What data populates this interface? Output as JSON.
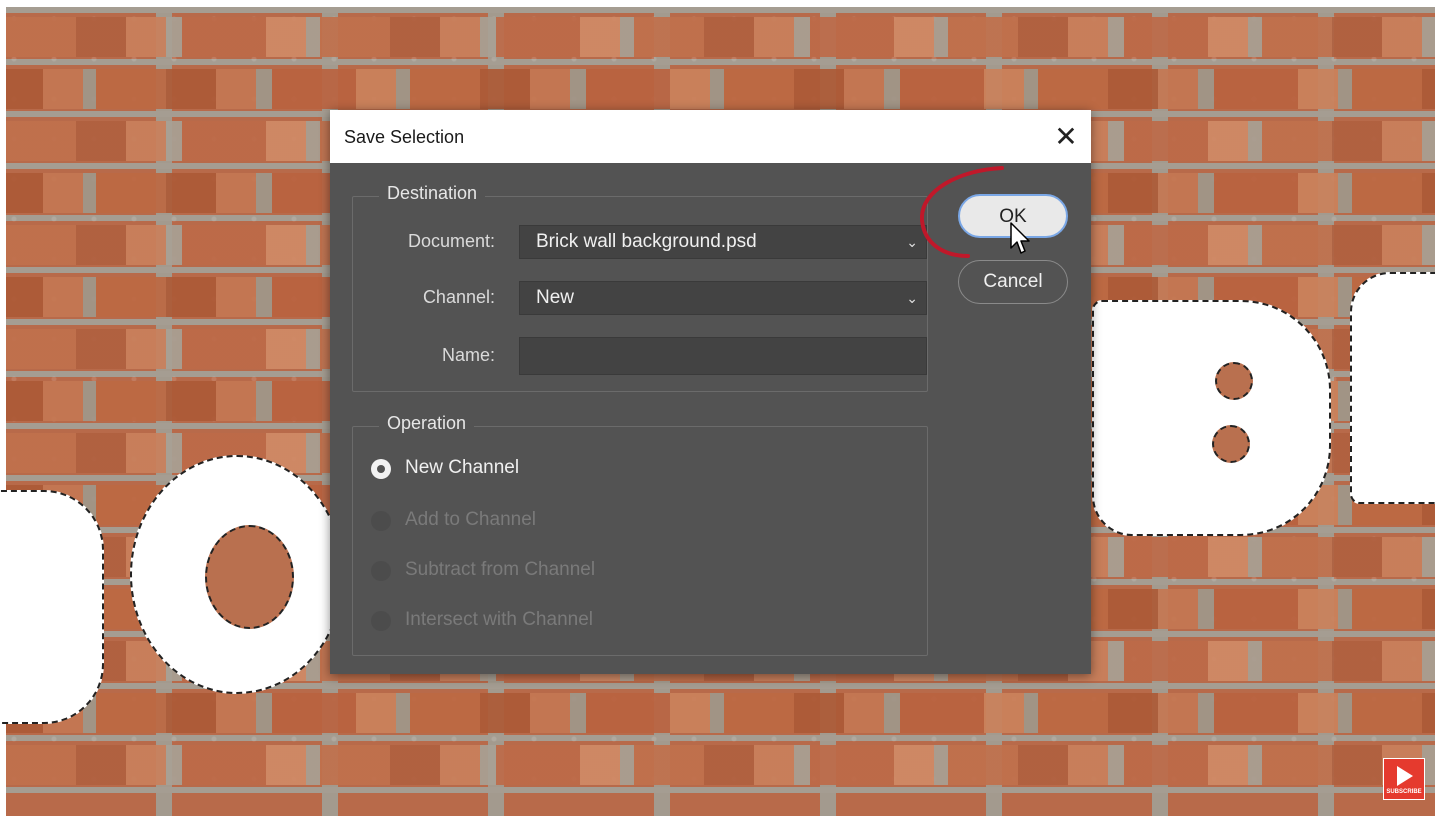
{
  "dialog": {
    "title": "Save Selection",
    "close_glyph": "✕",
    "destination": {
      "legend": "Destination",
      "document_label": "Document:",
      "document_value": "Brick wall background.psd",
      "channel_label": "Channel:",
      "channel_value": "New",
      "name_label": "Name:",
      "name_value": ""
    },
    "operation": {
      "legend": "Operation",
      "options": [
        {
          "label": "New Channel",
          "selected": true,
          "enabled": true
        },
        {
          "label": "Add to Channel",
          "selected": false,
          "enabled": false
        },
        {
          "label": "Subtract from Channel",
          "selected": false,
          "enabled": false
        },
        {
          "label": "Intersect with Channel",
          "selected": false,
          "enabled": false
        }
      ]
    },
    "buttons": {
      "ok": "OK",
      "cancel": "Cancel"
    }
  },
  "overlay": {
    "subscribe_label": "SUBSCRIBE"
  },
  "colors": {
    "dialog_bg": "#535353",
    "field_bg": "#434343",
    "ok_focus_ring": "#7aa7e6",
    "annotation_red": "#c0182a",
    "subscribe_red": "#e53a2e"
  },
  "icons": {
    "close": "close-icon",
    "dropdown": "chevron-down-icon",
    "cursor": "mouse-pointer-icon",
    "subscribe": "play-icon"
  }
}
